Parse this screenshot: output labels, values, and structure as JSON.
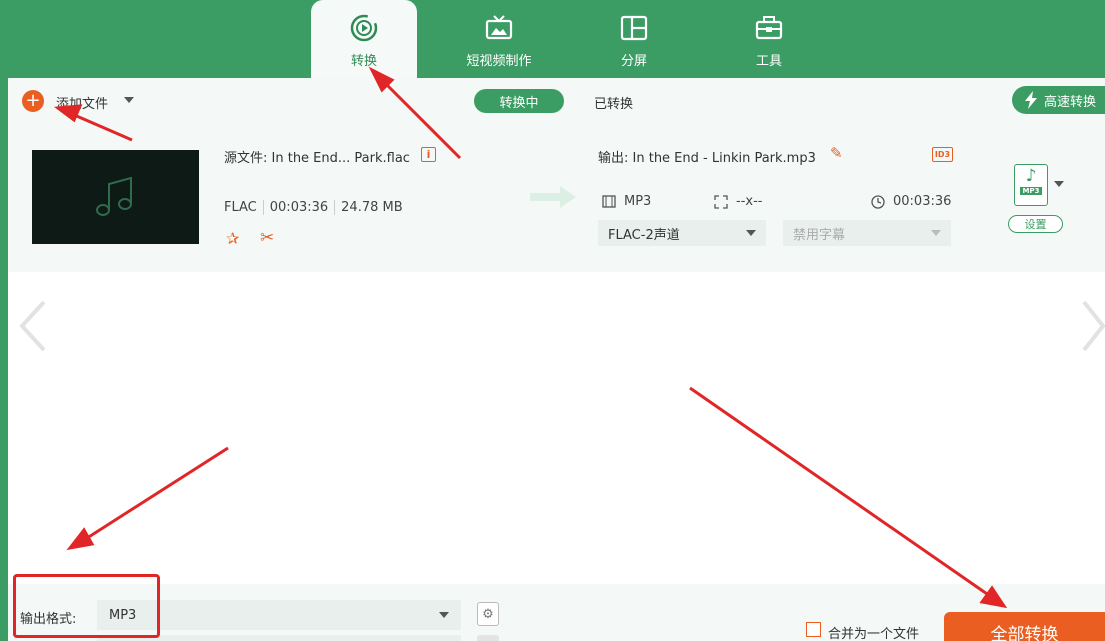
{
  "nav": {
    "tabs": [
      {
        "label": "转换",
        "icon": "convert-icon",
        "active": true
      },
      {
        "label": "短视频制作",
        "icon": "tv-icon",
        "active": false
      },
      {
        "label": "分屏",
        "icon": "split-screen-icon",
        "active": false
      },
      {
        "label": "工具",
        "icon": "toolbox-icon",
        "active": false
      }
    ]
  },
  "toolbar": {
    "add_file_label": "添加文件",
    "converting_label": "转换中",
    "converted_label": "已转换",
    "fast_convert_label": "高速转换"
  },
  "file": {
    "source_label": "源文件:  In the End... Park.flac",
    "format": "FLAC",
    "duration": "00:03:36",
    "size": "24.78 MB",
    "output_label": "输出:  In the End - Linkin Park.mp3",
    "output_format": "MP3",
    "resolution": "--x--",
    "output_duration": "00:03:36",
    "audio_track": "FLAC-2声道",
    "subtitle": "禁用字幕",
    "format_icon_tag": "MP3",
    "settings_label": "设置"
  },
  "bottom": {
    "output_format_label": "输出格式:",
    "output_format_value": "MP3",
    "merge_label": "合并为一个文件",
    "convert_all_label": "全部转换"
  },
  "colors": {
    "brand_green": "#3c9d64",
    "accent_orange": "#ea5f21",
    "annotation_red": "#e02626"
  }
}
